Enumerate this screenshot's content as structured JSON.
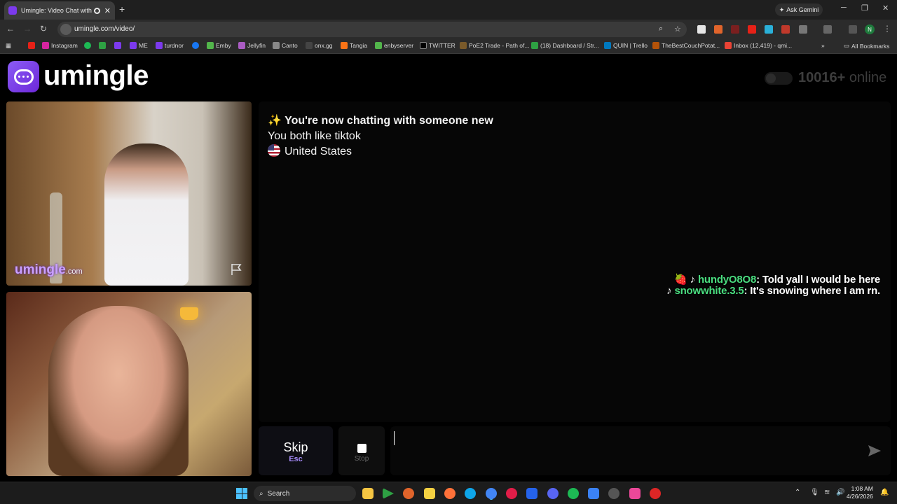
{
  "browser": {
    "tab_title": "Umingle: Video Chat with S",
    "tab_close": "✕",
    "new_tab": "+",
    "gemini": "Ask Gemini",
    "url": "umingle.com/video/",
    "profile_initial": "N",
    "bookmarks": [
      "Instagram",
      "ME",
      "turdnor",
      "Emby",
      "Jellyfin",
      "Canto",
      "onx.gg",
      "Tangia",
      "enbyserver",
      "TWITTER",
      "PoE2 Trade - Path of...",
      "(18) Dashboard / Str...",
      "QUIN | Trello",
      "TheBestCouchPotat...",
      "Inbox (12,419) - qmi..."
    ],
    "all_bookmarks": "All Bookmarks"
  },
  "site": {
    "logo_text": "umingle",
    "online_count": "10016+",
    "online_label": "online",
    "watermark_main": "umingle",
    "watermark_suffix": ".com"
  },
  "chat": {
    "system_line1": "✨ You're now chatting with someone new",
    "system_line2": "You both like tiktok",
    "system_line3": "United States",
    "overlay": [
      {
        "prefix": "🍓 ♪ ",
        "user": "hundyO8O8",
        "text": ": Told yall I would be here"
      },
      {
        "prefix": "♪ ",
        "user": "snowwhite.3.5",
        "text": ": It's snowing where I am rn."
      }
    ]
  },
  "controls": {
    "skip_label": "Skip",
    "skip_key": "Esc",
    "stop_label": "Stop",
    "message_placeholder": ""
  },
  "taskbar": {
    "search_label": "Search",
    "time": "1:08 AM",
    "date": "4/26/2026"
  },
  "colors": {
    "brand": "#7c3aed",
    "chat_username": "#4ade80",
    "skip_key": "#a78bfa"
  }
}
